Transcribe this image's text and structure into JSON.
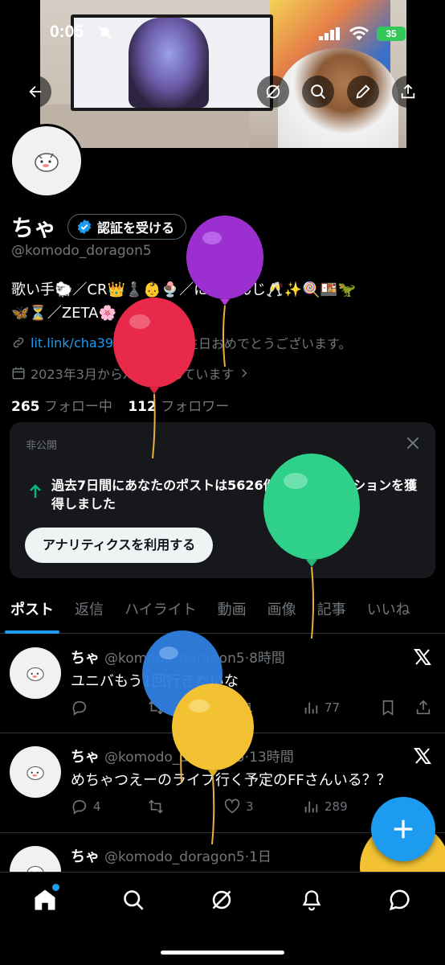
{
  "status_bar": {
    "time": "0:05",
    "battery": "35"
  },
  "profile": {
    "name": "ちゃ",
    "verify_label": "認証を受ける",
    "handle": "@komodo_doragon5",
    "bio_line1": "歌い手🐑／CR👑♟️👶🍨／にじさんじ🥂✨🍭🍱🦖",
    "bio_line2": "🦋⏳／ZETA🌸",
    "link": "lit.link/cha39",
    "birthday": "お誕生日おめでとうございます。",
    "joined": "2023年3月からXを利用しています",
    "following_count": "265",
    "following_label": "フォロー中",
    "followers_count": "112",
    "followers_label": "フォロワー"
  },
  "analytics": {
    "private_label": "非公開",
    "message": "過去7日間にあなたのポストは5626件のインプレッションを獲得しました",
    "button": "アナリティクスを利用する"
  },
  "tabs": [
    "ポスト",
    "返信",
    "ハイライト",
    "動画",
    "画像",
    "記事",
    "いいね"
  ],
  "posts": [
    {
      "name": "ちゃ",
      "handle": "@komodo_doragon5",
      "time": "·8時間",
      "text": "ユニバもう1回行きたいな",
      "replies": "",
      "reposts": "",
      "likes": "1",
      "views": "77"
    },
    {
      "name": "ちゃ",
      "handle": "@komodo_doragon5",
      "time": "·13時間",
      "text": "めちゃつえーのライブ行く予定のFFさんいる？？",
      "replies": "4",
      "reposts": "",
      "likes": "3",
      "views": "289"
    },
    {
      "name": "ちゃ",
      "handle": "@komodo_doragon5",
      "time": "·1日",
      "text": ""
    }
  ],
  "colors": {
    "accent": "#1d9bf0",
    "background": "#000000",
    "verified": "#1d9bf0"
  }
}
